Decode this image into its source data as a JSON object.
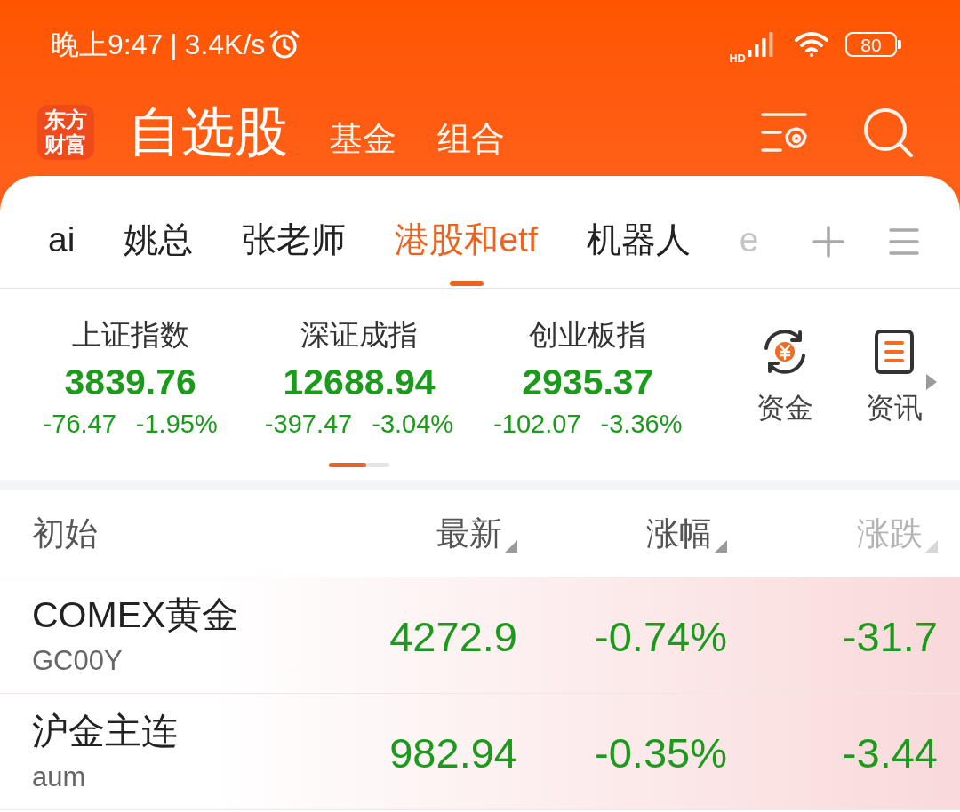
{
  "status_bar": {
    "time": "晚上9:47",
    "separator": "|",
    "speed": "3.4K/s",
    "network_type": "HD",
    "battery": "80"
  },
  "header": {
    "logo": "东方财富",
    "nav": [
      {
        "label": "自选股",
        "selected": true
      },
      {
        "label": "基金",
        "selected": false
      },
      {
        "label": "组合",
        "selected": false
      }
    ]
  },
  "tabs": [
    {
      "label": "ai",
      "selected": false,
      "faded": false
    },
    {
      "label": "姚总",
      "selected": false,
      "faded": false
    },
    {
      "label": "张老师",
      "selected": false,
      "faded": false
    },
    {
      "label": "港股和etf",
      "selected": true,
      "faded": false
    },
    {
      "label": "机器人",
      "selected": false,
      "faded": false
    },
    {
      "label": "e",
      "selected": false,
      "faded": true
    }
  ],
  "indices": [
    {
      "name": "上证指数",
      "value": "3839.76",
      "change": "-76.47",
      "percent": "-1.95%",
      "falling": true
    },
    {
      "name": "深证成指",
      "value": "12688.94",
      "change": "-397.47",
      "percent": "-3.04%",
      "falling": true
    },
    {
      "name": "创业板指",
      "value": "2935.37",
      "change": "-102.07",
      "percent": "-3.36%",
      "falling": true
    }
  ],
  "quick_links": [
    {
      "label": "资金",
      "kind": "funds"
    },
    {
      "label": "资讯",
      "kind": "news"
    }
  ],
  "table": {
    "columns": [
      {
        "label": "初始",
        "sortable": false,
        "faded": false
      },
      {
        "label": "最新",
        "sortable": true,
        "faded": false
      },
      {
        "label": "涨幅",
        "sortable": true,
        "faded": false
      },
      {
        "label": "涨跌",
        "sortable": true,
        "faded": true
      }
    ],
    "rows": [
      {
        "name": "COMEX黄金",
        "code": "GC00Y",
        "latest": "4272.9",
        "percent": "-0.74%",
        "change": "-31.7",
        "falling": true
      },
      {
        "name": "沪金主连",
        "code": "aum",
        "latest": "982.94",
        "percent": "-0.35%",
        "change": "-3.44",
        "falling": true
      }
    ]
  }
}
